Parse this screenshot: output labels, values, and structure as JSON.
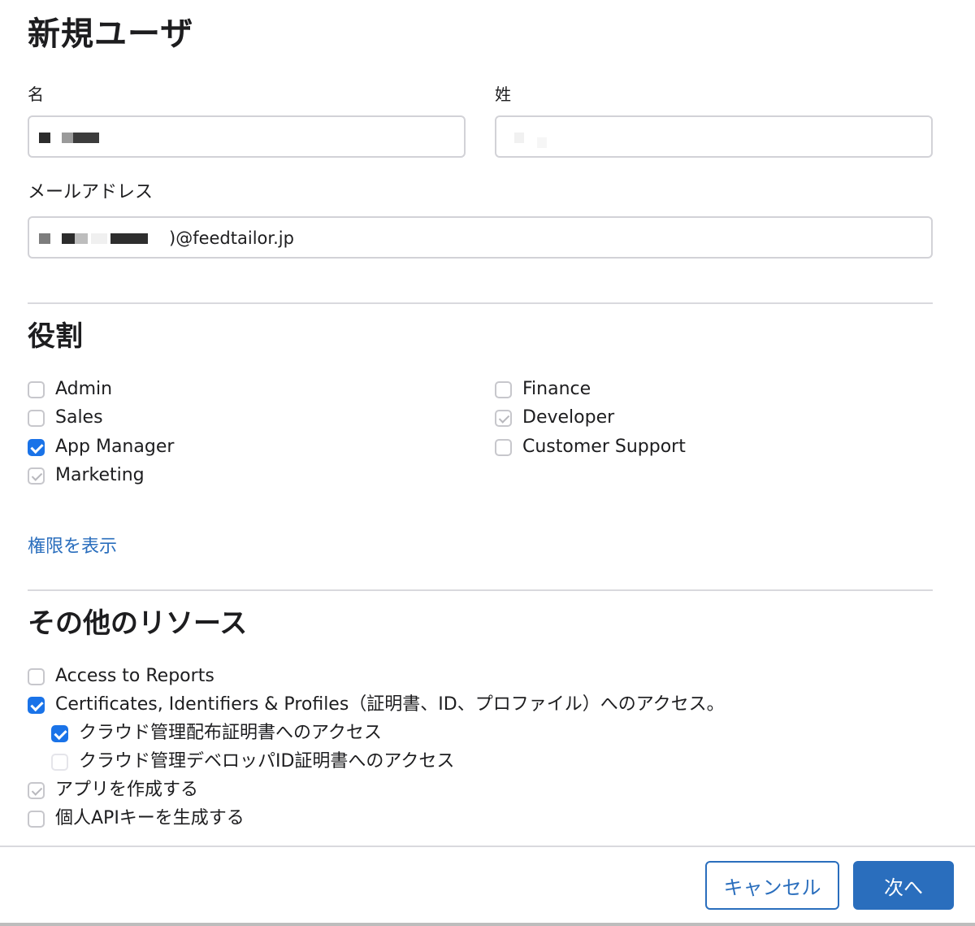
{
  "header": {
    "title": "新規ユーザ"
  },
  "form": {
    "first_name": {
      "label": "名",
      "value": ""
    },
    "last_name": {
      "label": "姓",
      "value": ""
    },
    "email": {
      "label": "メールアドレス",
      "value": ")@feedtailor.jp"
    }
  },
  "roles": {
    "title": "役割",
    "items": [
      {
        "label": "Admin",
        "state": "unchecked"
      },
      {
        "label": "Sales",
        "state": "unchecked"
      },
      {
        "label": "App Manager",
        "state": "checked"
      },
      {
        "label": "Marketing",
        "state": "disabled-checked"
      },
      {
        "label": "Finance",
        "state": "unchecked"
      },
      {
        "label": "Developer",
        "state": "disabled-checked"
      },
      {
        "label": "Customer Support",
        "state": "unchecked"
      }
    ],
    "show_permissions_link": "権限を表示"
  },
  "resources": {
    "title": "その他のリソース",
    "items": [
      {
        "label": "Access to Reports",
        "state": "unchecked"
      },
      {
        "label": "Certificates, Identifiers & Profiles（証明書、ID、プロファイル）へのアクセス。",
        "state": "checked"
      },
      {
        "label": "クラウド管理配布証明書へのアクセス",
        "state": "checked"
      },
      {
        "label": "クラウド管理デベロッパID証明書へのアクセス",
        "state": "unchecked-faint"
      },
      {
        "label": "アプリを作成する",
        "state": "disabled-checked"
      },
      {
        "label": "個人APIキーを生成する",
        "state": "unchecked"
      }
    ]
  },
  "footer": {
    "cancel_label": "キャンセル",
    "next_label": "次へ"
  },
  "colors": {
    "accent": "#2a6ebd",
    "checkbox_checked": "#1a73e8",
    "border": "#d2d2d7"
  }
}
